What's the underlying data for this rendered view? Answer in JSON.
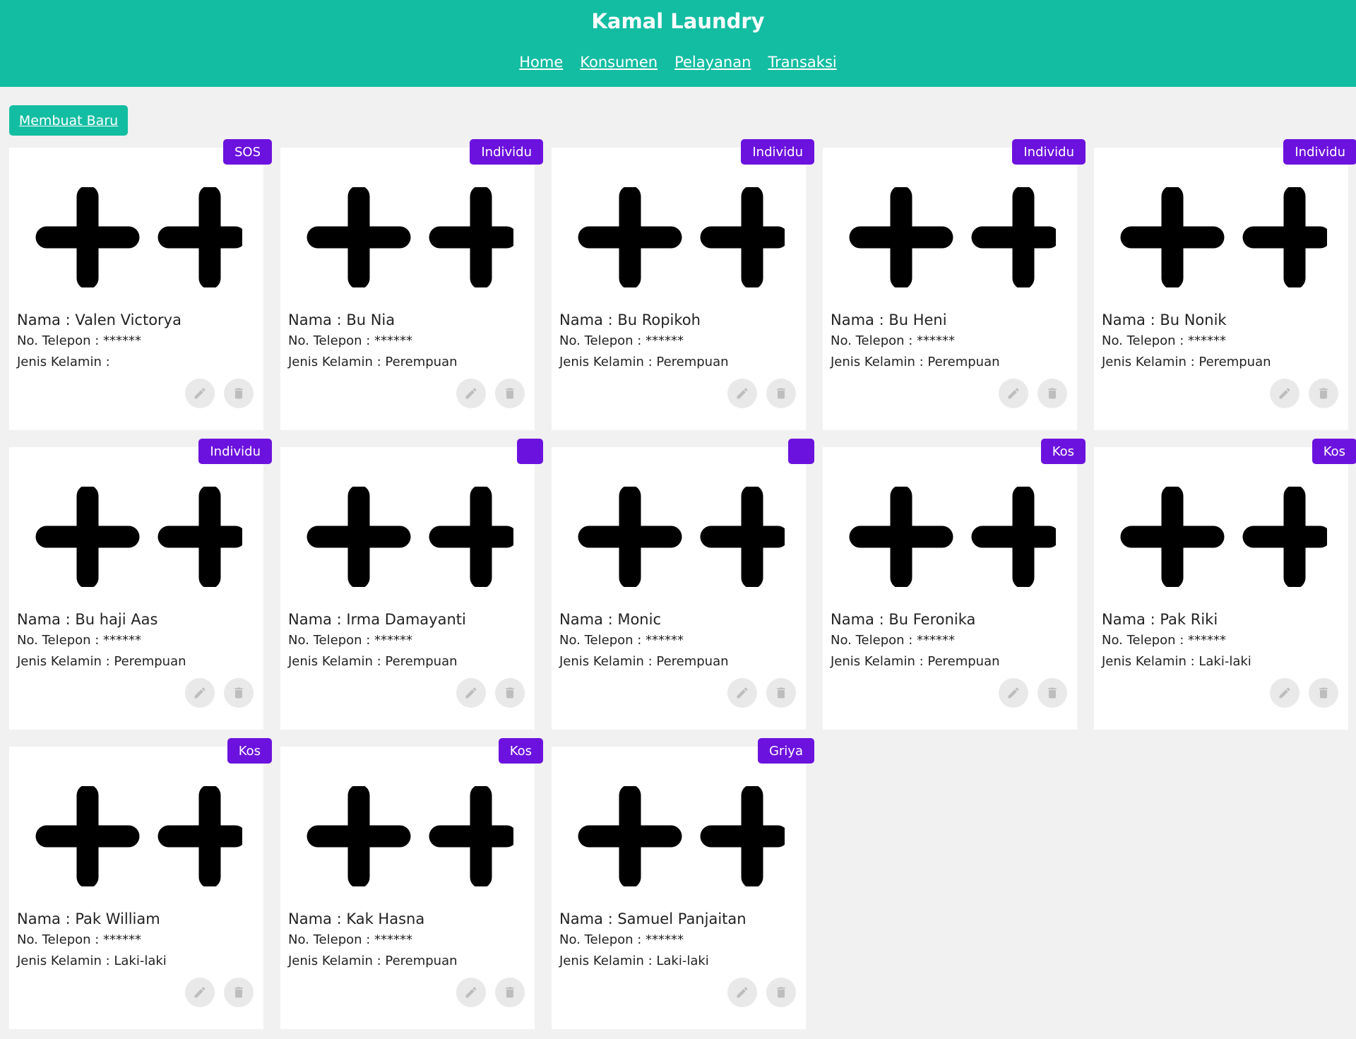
{
  "app": {
    "brand": "Kamal Laundry",
    "nav": [
      "Home",
      "Konsumen",
      "Pelayanan",
      "Transaksi"
    ],
    "accent": "#13bda2",
    "badge_color": "#6c12de"
  },
  "toolbar": {
    "new_label": "Membuat Baru"
  },
  "labels": {
    "nama": "Nama : ",
    "telepon": "No. Telepon : ",
    "kelamin": "Jenis Kelamin : "
  },
  "customers": [
    {
      "type": "SOS",
      "name": "Valen Victorya",
      "phone": "******",
      "gender": ""
    },
    {
      "type": "Individu",
      "name": "Bu Nia",
      "phone": "******",
      "gender": "Perempuan"
    },
    {
      "type": "Individu",
      "name": "Bu Ropikoh",
      "phone": "******",
      "gender": "Perempuan"
    },
    {
      "type": "Individu",
      "name": "Bu Heni",
      "phone": "******",
      "gender": "Perempuan"
    },
    {
      "type": "Individu",
      "name": "Bu Nonik",
      "phone": "******",
      "gender": "Perempuan"
    },
    {
      "type": "Individu",
      "name": "Bu haji Aas",
      "phone": "******",
      "gender": "Perempuan"
    },
    {
      "type": "",
      "name": "Irma Damayanti",
      "phone": "******",
      "gender": "Perempuan"
    },
    {
      "type": "",
      "name": "Monic",
      "phone": "******",
      "gender": "Perempuan"
    },
    {
      "type": "Kos",
      "name": "Bu Feronika",
      "phone": "******",
      "gender": "Perempuan"
    },
    {
      "type": "Kos",
      "name": "Pak Riki",
      "phone": "******",
      "gender": "Laki-laki"
    },
    {
      "type": "Kos",
      "name": "Pak William",
      "phone": "******",
      "gender": "Laki-laki"
    },
    {
      "type": "Kos",
      "name": "Kak Hasna",
      "phone": "******",
      "gender": "Perempuan"
    },
    {
      "type": "Griya",
      "name": "Samuel Panjaitan",
      "phone": "******",
      "gender": "Laki-laki"
    }
  ],
  "icons": {
    "image": "plus-plus-icon",
    "edit": "pencil-icon",
    "delete": "trash-icon"
  }
}
